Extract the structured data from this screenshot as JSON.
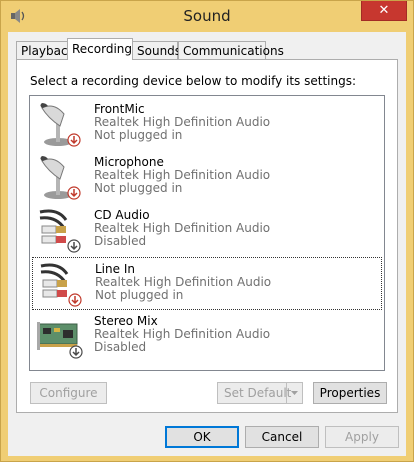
{
  "window": {
    "title": "Sound",
    "close_glyph": "✕"
  },
  "tabs": [
    {
      "label": "Playback",
      "active": false
    },
    {
      "label": "Recording",
      "active": true
    },
    {
      "label": "Sounds",
      "active": false
    },
    {
      "label": "Communications",
      "active": false
    }
  ],
  "recording": {
    "prompt": "Select a recording device below to modify its settings:",
    "devices": [
      {
        "name": "FrontMic",
        "driver": "Realtek High Definition Audio",
        "status": "Not plugged in",
        "icon": "microphone-icon",
        "badge": "red-down-arrow"
      },
      {
        "name": "Microphone",
        "driver": "Realtek High Definition Audio",
        "status": "Not plugged in",
        "icon": "microphone-icon",
        "badge": "red-down-arrow"
      },
      {
        "name": "CD Audio",
        "driver": "Realtek High Definition Audio",
        "status": "Disabled",
        "icon": "rca-cable-icon",
        "badge": "gray-down-arrow"
      },
      {
        "name": "Line In",
        "driver": "Realtek High Definition Audio",
        "status": "Not plugged in",
        "icon": "rca-cable-icon",
        "badge": "red-down-arrow",
        "selected": true
      },
      {
        "name": "Stereo Mix",
        "driver": "Realtek High Definition Audio",
        "status": "Disabled",
        "icon": "sound-card-icon",
        "badge": "gray-down-arrow"
      }
    ],
    "configure_label": "Configure",
    "set_default_label": "Set Default",
    "properties_label": "Properties"
  },
  "dialog": {
    "ok_label": "OK",
    "cancel_label": "Cancel",
    "apply_label": "Apply"
  },
  "colors": {
    "frame": "#f0ce74",
    "close": "#c7372f",
    "disabled_badge": "#4a4a4a",
    "unplugged_badge": "#c0392b"
  }
}
